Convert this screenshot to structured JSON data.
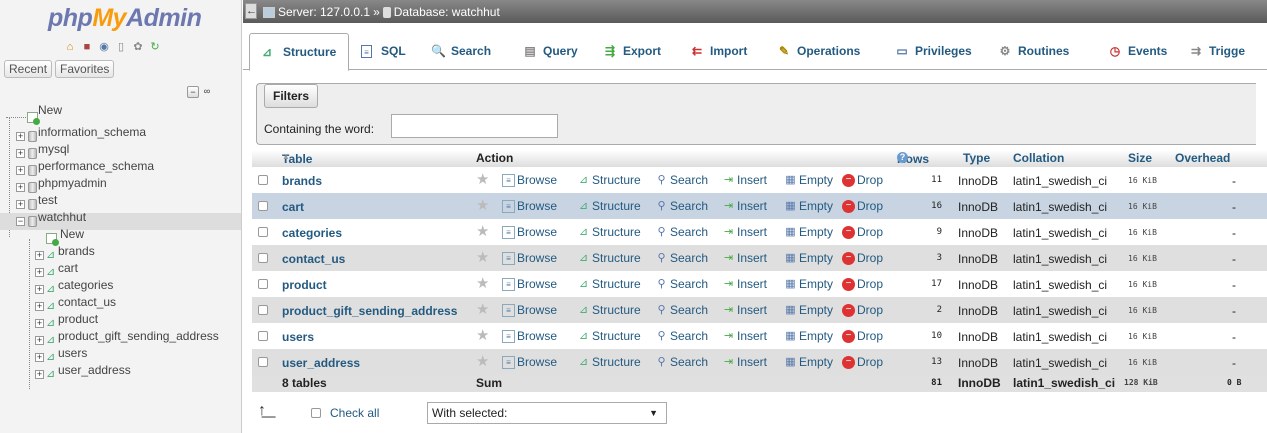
{
  "logo": {
    "part1": "php",
    "part2": "My",
    "part3": "Admin"
  },
  "nav": {
    "recent": "Recent",
    "favorites": "Favorites",
    "databases": [
      {
        "name": "New",
        "kind": "new"
      },
      {
        "name": "information_schema",
        "kind": "db"
      },
      {
        "name": "mysql",
        "kind": "db"
      },
      {
        "name": "performance_schema",
        "kind": "db"
      },
      {
        "name": "phpmyadmin",
        "kind": "db"
      },
      {
        "name": "test",
        "kind": "db"
      },
      {
        "name": "watchhut",
        "kind": "db"
      }
    ],
    "watchhut_children": [
      {
        "name": "New"
      },
      {
        "name": "brands"
      },
      {
        "name": "cart"
      },
      {
        "name": "categories"
      },
      {
        "name": "contact_us"
      },
      {
        "name": "product"
      },
      {
        "name": "product_gift_sending_address"
      },
      {
        "name": "users"
      },
      {
        "name": "user_address"
      }
    ]
  },
  "breadcrumb": {
    "server": "Server: 127.0.0.1",
    "sep": "»",
    "database": "Database: watchhut"
  },
  "tabs": [
    {
      "label": "Structure",
      "icon": "structure-icon"
    },
    {
      "label": "SQL",
      "icon": "sql-icon"
    },
    {
      "label": "Search",
      "icon": "search-icon"
    },
    {
      "label": "Query",
      "icon": "query-icon"
    },
    {
      "label": "Export",
      "icon": "export-icon"
    },
    {
      "label": "Import",
      "icon": "import-icon"
    },
    {
      "label": "Operations",
      "icon": "operations-icon"
    },
    {
      "label": "Privileges",
      "icon": "privileges-icon"
    },
    {
      "label": "Routines",
      "icon": "routines-icon"
    },
    {
      "label": "Events",
      "icon": "events-icon"
    },
    {
      "label": "Trigge",
      "icon": "triggers-icon"
    }
  ],
  "filters": {
    "legend": "Filters",
    "label": "Containing the word:",
    "value": ""
  },
  "table": {
    "headers": {
      "table": "Table",
      "sort_arrow": "▲",
      "action": "Action",
      "rows": "Rows",
      "type": "Type",
      "collation": "Collation",
      "size": "Size",
      "overhead": "Overhead"
    },
    "actions": {
      "browse": "Browse",
      "structure": "Structure",
      "search": "Search",
      "insert": "Insert",
      "empty": "Empty",
      "drop": "Drop"
    },
    "rows": [
      {
        "name": "brands",
        "rows": "11",
        "type": "InnoDB",
        "collation": "latin1_swedish_ci",
        "size": "16 KiB",
        "overhead": "-"
      },
      {
        "name": "cart",
        "rows": "16",
        "type": "InnoDB",
        "collation": "latin1_swedish_ci",
        "size": "16 KiB",
        "overhead": "-"
      },
      {
        "name": "categories",
        "rows": "9",
        "type": "InnoDB",
        "collation": "latin1_swedish_ci",
        "size": "16 KiB",
        "overhead": "-"
      },
      {
        "name": "contact_us",
        "rows": "3",
        "type": "InnoDB",
        "collation": "latin1_swedish_ci",
        "size": "16 KiB",
        "overhead": "-"
      },
      {
        "name": "product",
        "rows": "17",
        "type": "InnoDB",
        "collation": "latin1_swedish_ci",
        "size": "16 KiB",
        "overhead": "-"
      },
      {
        "name": "product_gift_sending_address",
        "rows": "2",
        "type": "InnoDB",
        "collation": "latin1_swedish_ci",
        "size": "16 KiB",
        "overhead": "-"
      },
      {
        "name": "users",
        "rows": "10",
        "type": "InnoDB",
        "collation": "latin1_swedish_ci",
        "size": "16 KiB",
        "overhead": "-"
      },
      {
        "name": "user_address",
        "rows": "13",
        "type": "InnoDB",
        "collation": "latin1_swedish_ci",
        "size": "16 KiB",
        "overhead": "-"
      }
    ],
    "summary": {
      "count": "8 tables",
      "label": "Sum",
      "rows": "81",
      "type": "InnoDB",
      "collation": "latin1_swedish_ci",
      "size": "128 KiB",
      "overhead": "0 B"
    }
  },
  "footer": {
    "check_all": "Check all",
    "with_selected": "With selected:"
  },
  "colors": {
    "link": "#235a81",
    "topbar": "#6f6f6f",
    "logo_blue": "#6c78af",
    "logo_orange": "#f89c0e"
  }
}
